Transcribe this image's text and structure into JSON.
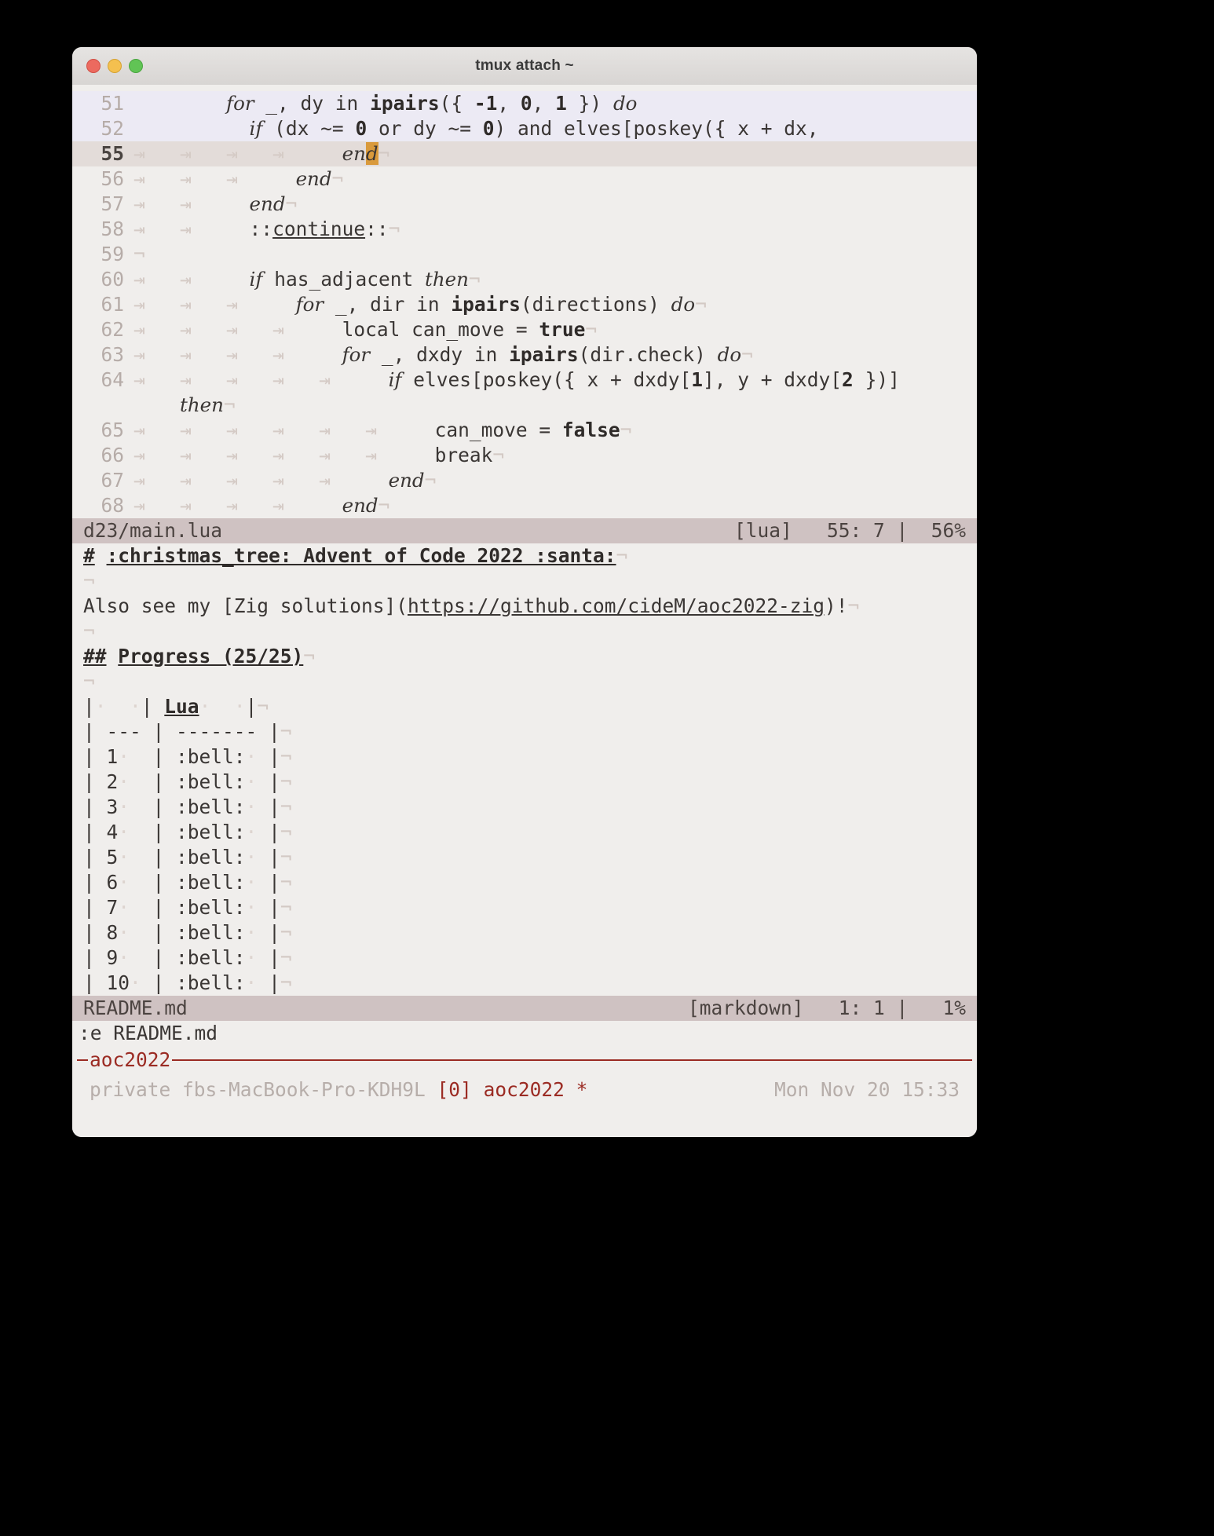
{
  "window": {
    "title": "tmux attach ~",
    "traffic_lights": [
      "close-red",
      "minimize-yellow",
      "zoom-green"
    ]
  },
  "editor": {
    "lines": [
      {
        "num": "51",
        "tabs": 0,
        "state": "fold",
        "segments": [
          {
            "t": "        ",
            "c": "plain"
          },
          {
            "t": "for",
            "c": "kw"
          },
          {
            "t": " _, dy in ",
            "c": "plain"
          },
          {
            "t": "ipairs",
            "c": "fn"
          },
          {
            "t": "({ ",
            "c": "plain"
          },
          {
            "t": "-1",
            "c": "num"
          },
          {
            "t": ", ",
            "c": "plain"
          },
          {
            "t": "0",
            "c": "num"
          },
          {
            "t": ", ",
            "c": "plain"
          },
          {
            "t": "1",
            "c": "num"
          },
          {
            "t": " }) ",
            "c": "plain"
          },
          {
            "t": "do",
            "c": "kw"
          }
        ]
      },
      {
        "num": "52",
        "tabs": 0,
        "state": "fold",
        "segments": [
          {
            "t": "          ",
            "c": "plain"
          },
          {
            "t": "if",
            "c": "kw"
          },
          {
            "t": " (dx ~= ",
            "c": "plain"
          },
          {
            "t": "0",
            "c": "num"
          },
          {
            "t": " or dy ~= ",
            "c": "plain"
          },
          {
            "t": "0",
            "c": "num"
          },
          {
            "t": ") and elves[poskey({ x + dx,",
            "c": "plain"
          }
        ]
      },
      {
        "num": "55",
        "tabs": 4,
        "state": "cursor",
        "segments": [
          {
            "t": "  ",
            "c": "plain"
          },
          {
            "t": "en",
            "c": "kw"
          },
          {
            "t": "d",
            "c": "cursor-kw"
          },
          {
            "t": "¬",
            "c": "eol"
          }
        ]
      },
      {
        "num": "56",
        "tabs": 3,
        "state": "normal",
        "segments": [
          {
            "t": "  ",
            "c": "plain"
          },
          {
            "t": "end",
            "c": "kw"
          },
          {
            "t": "¬",
            "c": "eol"
          }
        ]
      },
      {
        "num": "57",
        "tabs": 2,
        "state": "normal",
        "segments": [
          {
            "t": "  ",
            "c": "plain"
          },
          {
            "t": "end",
            "c": "kw"
          },
          {
            "t": "¬",
            "c": "eol"
          }
        ]
      },
      {
        "num": "58",
        "tabs": 2,
        "state": "normal",
        "segments": [
          {
            "t": "  ",
            "c": "plain"
          },
          {
            "t": "::",
            "c": "plain"
          },
          {
            "t": "continue",
            "c": "lbl"
          },
          {
            "t": "::",
            "c": "plain"
          },
          {
            "t": "¬",
            "c": "eol"
          }
        ]
      },
      {
        "num": "59",
        "tabs": 0,
        "state": "normal",
        "segments": [
          {
            "t": "¬",
            "c": "eol"
          }
        ]
      },
      {
        "num": "60",
        "tabs": 2,
        "state": "normal",
        "segments": [
          {
            "t": "  ",
            "c": "plain"
          },
          {
            "t": "if",
            "c": "kw"
          },
          {
            "t": " has_adjacent ",
            "c": "plain"
          },
          {
            "t": "then",
            "c": "kw"
          },
          {
            "t": "¬",
            "c": "eol"
          }
        ]
      },
      {
        "num": "61",
        "tabs": 3,
        "state": "normal",
        "segments": [
          {
            "t": "  ",
            "c": "plain"
          },
          {
            "t": "for",
            "c": "kw"
          },
          {
            "t": " _, dir in ",
            "c": "plain"
          },
          {
            "t": "ipairs",
            "c": "fn"
          },
          {
            "t": "(directions) ",
            "c": "plain"
          },
          {
            "t": "do",
            "c": "kw"
          },
          {
            "t": "¬",
            "c": "eol"
          }
        ]
      },
      {
        "num": "62",
        "tabs": 4,
        "state": "normal",
        "segments": [
          {
            "t": "  ",
            "c": "plain"
          },
          {
            "t": "local can_move = ",
            "c": "plain"
          },
          {
            "t": "true",
            "c": "bool"
          },
          {
            "t": "¬",
            "c": "eol"
          }
        ]
      },
      {
        "num": "63",
        "tabs": 4,
        "state": "normal",
        "segments": [
          {
            "t": "  ",
            "c": "plain"
          },
          {
            "t": "for",
            "c": "kw"
          },
          {
            "t": " _, dxdy in ",
            "c": "plain"
          },
          {
            "t": "ipairs",
            "c": "fn"
          },
          {
            "t": "(dir.check) ",
            "c": "plain"
          },
          {
            "t": "do",
            "c": "kw"
          },
          {
            "t": "¬",
            "c": "eol"
          }
        ]
      },
      {
        "num": "64",
        "tabs": 5,
        "state": "normal",
        "segments": [
          {
            "t": "  ",
            "c": "plain"
          },
          {
            "t": "if",
            "c": "kw"
          },
          {
            "t": " elves[poskey({ x + dxdy[",
            "c": "plain"
          },
          {
            "t": "1",
            "c": "num"
          },
          {
            "t": "], y + dxdy[",
            "c": "plain"
          },
          {
            "t": "2",
            "c": "num"
          },
          {
            "t": " })]",
            "c": "plain"
          }
        ]
      },
      {
        "num": "",
        "tabs": 0,
        "state": "wrap",
        "segments": [
          {
            "t": "    ",
            "c": "plain"
          },
          {
            "t": "then",
            "c": "kw"
          },
          {
            "t": "¬",
            "c": "eol"
          }
        ]
      },
      {
        "num": "65",
        "tabs": 6,
        "state": "normal",
        "segments": [
          {
            "t": "  ",
            "c": "plain"
          },
          {
            "t": "can_move = ",
            "c": "plain"
          },
          {
            "t": "false",
            "c": "bool"
          },
          {
            "t": "¬",
            "c": "eol"
          }
        ]
      },
      {
        "num": "66",
        "tabs": 6,
        "state": "normal",
        "segments": [
          {
            "t": "  ",
            "c": "plain"
          },
          {
            "t": "break",
            "c": "plain"
          },
          {
            "t": "¬",
            "c": "eol"
          }
        ]
      },
      {
        "num": "67",
        "tabs": 5,
        "state": "normal",
        "segments": [
          {
            "t": "  ",
            "c": "plain"
          },
          {
            "t": "end",
            "c": "kw"
          },
          {
            "t": "¬",
            "c": "eol"
          }
        ]
      },
      {
        "num": "68",
        "tabs": 4,
        "state": "normal",
        "segments": [
          {
            "t": "  ",
            "c": "plain"
          },
          {
            "t": "end",
            "c": "kw"
          },
          {
            "t": "¬",
            "c": "eol"
          }
        ]
      }
    ],
    "statusline": {
      "filename": "d23/main.lua",
      "filetype": "[lua]",
      "position": "55: 7 |  56%"
    }
  },
  "readme": {
    "lines": [
      {
        "segments": [
          {
            "t": "#",
            "c": "hd"
          },
          {
            "t": " ",
            "c": "plain"
          },
          {
            "t": ":christmas_tree: Advent of Code 2022 :santa:",
            "c": "hd"
          },
          {
            "t": "¬",
            "c": "eol"
          }
        ]
      },
      {
        "segments": [
          {
            "t": "¬",
            "c": "eol"
          }
        ]
      },
      {
        "segments": [
          {
            "t": "Also see my [Zig solutions](",
            "c": "plain"
          },
          {
            "t": "https://github.com/cideM/aoc2022-zig",
            "c": "url"
          },
          {
            "t": ")!",
            "c": "plain"
          },
          {
            "t": "¬",
            "c": "eol"
          }
        ]
      },
      {
        "segments": [
          {
            "t": "¬",
            "c": "eol"
          }
        ]
      },
      {
        "segments": [
          {
            "t": "##",
            "c": "hd"
          },
          {
            "t": " ",
            "c": "plain"
          },
          {
            "t": "Progress (25/25)",
            "c": "hd"
          },
          {
            "t": "¬",
            "c": "eol"
          }
        ]
      },
      {
        "segments": [
          {
            "t": "¬",
            "c": "eol"
          }
        ]
      },
      {
        "segments": [
          {
            "t": "|",
            "c": "plain"
          },
          {
            "t": "·  ·",
            "c": "dot"
          },
          {
            "t": "| ",
            "c": "plain"
          },
          {
            "t": "Lua",
            "c": "hd"
          },
          {
            "t": "·  ·",
            "c": "dot"
          },
          {
            "t": "|",
            "c": "plain"
          },
          {
            "t": "¬",
            "c": "eol"
          }
        ]
      },
      {
        "segments": [
          {
            "t": "| --- | ------- |",
            "c": "plain"
          },
          {
            "t": "¬",
            "c": "eol"
          }
        ]
      },
      {
        "segments": [
          {
            "t": "| 1",
            "c": "plain"
          },
          {
            "t": "·",
            "c": "dot"
          },
          {
            "t": "  | :bell:",
            "c": "plain"
          },
          {
            "t": "·",
            "c": "dot"
          },
          {
            "t": " |",
            "c": "plain"
          },
          {
            "t": "¬",
            "c": "eol"
          }
        ]
      },
      {
        "segments": [
          {
            "t": "| 2",
            "c": "plain"
          },
          {
            "t": "·",
            "c": "dot"
          },
          {
            "t": "  | :bell:",
            "c": "plain"
          },
          {
            "t": "·",
            "c": "dot"
          },
          {
            "t": " |",
            "c": "plain"
          },
          {
            "t": "¬",
            "c": "eol"
          }
        ]
      },
      {
        "segments": [
          {
            "t": "| 3",
            "c": "plain"
          },
          {
            "t": "·",
            "c": "dot"
          },
          {
            "t": "  | :bell:",
            "c": "plain"
          },
          {
            "t": "·",
            "c": "dot"
          },
          {
            "t": " |",
            "c": "plain"
          },
          {
            "t": "¬",
            "c": "eol"
          }
        ]
      },
      {
        "segments": [
          {
            "t": "| 4",
            "c": "plain"
          },
          {
            "t": "·",
            "c": "dot"
          },
          {
            "t": "  | :bell:",
            "c": "plain"
          },
          {
            "t": "·",
            "c": "dot"
          },
          {
            "t": " |",
            "c": "plain"
          },
          {
            "t": "¬",
            "c": "eol"
          }
        ]
      },
      {
        "segments": [
          {
            "t": "| 5",
            "c": "plain"
          },
          {
            "t": "·",
            "c": "dot"
          },
          {
            "t": "  | :bell:",
            "c": "plain"
          },
          {
            "t": "·",
            "c": "dot"
          },
          {
            "t": " |",
            "c": "plain"
          },
          {
            "t": "¬",
            "c": "eol"
          }
        ]
      },
      {
        "segments": [
          {
            "t": "| 6",
            "c": "plain"
          },
          {
            "t": "·",
            "c": "dot"
          },
          {
            "t": "  | :bell:",
            "c": "plain"
          },
          {
            "t": "·",
            "c": "dot"
          },
          {
            "t": " |",
            "c": "plain"
          },
          {
            "t": "¬",
            "c": "eol"
          }
        ]
      },
      {
        "segments": [
          {
            "t": "| 7",
            "c": "plain"
          },
          {
            "t": "·",
            "c": "dot"
          },
          {
            "t": "  | :bell:",
            "c": "plain"
          },
          {
            "t": "·",
            "c": "dot"
          },
          {
            "t": " |",
            "c": "plain"
          },
          {
            "t": "¬",
            "c": "eol"
          }
        ]
      },
      {
        "segments": [
          {
            "t": "| 8",
            "c": "plain"
          },
          {
            "t": "·",
            "c": "dot"
          },
          {
            "t": "  | :bell:",
            "c": "plain"
          },
          {
            "t": "·",
            "c": "dot"
          },
          {
            "t": " |",
            "c": "plain"
          },
          {
            "t": "¬",
            "c": "eol"
          }
        ]
      },
      {
        "segments": [
          {
            "t": "| 9",
            "c": "plain"
          },
          {
            "t": "·",
            "c": "dot"
          },
          {
            "t": "  | :bell:",
            "c": "plain"
          },
          {
            "t": "·",
            "c": "dot"
          },
          {
            "t": " |",
            "c": "plain"
          },
          {
            "t": "¬",
            "c": "eol"
          }
        ]
      },
      {
        "segments": [
          {
            "t": "| 10",
            "c": "plain"
          },
          {
            "t": "·",
            "c": "dot"
          },
          {
            "t": " | :bell:",
            "c": "plain"
          },
          {
            "t": "·",
            "c": "dot"
          },
          {
            "t": " |",
            "c": "plain"
          },
          {
            "t": "¬",
            "c": "eol"
          }
        ]
      }
    ],
    "statusline": {
      "filename": "README.md",
      "filetype": "[markdown]",
      "position": "1: 1 |   1%"
    }
  },
  "command": {
    "text": ":e README.md"
  },
  "tmux": {
    "window_name": "aoc2022",
    "host_prefix": "private fbs-MacBook-Pro-KDH9L",
    "session_index": "[0]",
    "session_name": "aoc2022",
    "flag": "*",
    "clock": "Mon Nov 20 15:33"
  },
  "colors": {
    "bg": "#f0eeec",
    "fold_bg": "#eceaf4",
    "cursorline_bg": "#e3dcd9",
    "statusline_bg": "#cfc2c2",
    "cursor": "#d99a3c",
    "accent_red": "#9b2b23",
    "text": "#3a3634",
    "dim": "#b6aca8"
  }
}
